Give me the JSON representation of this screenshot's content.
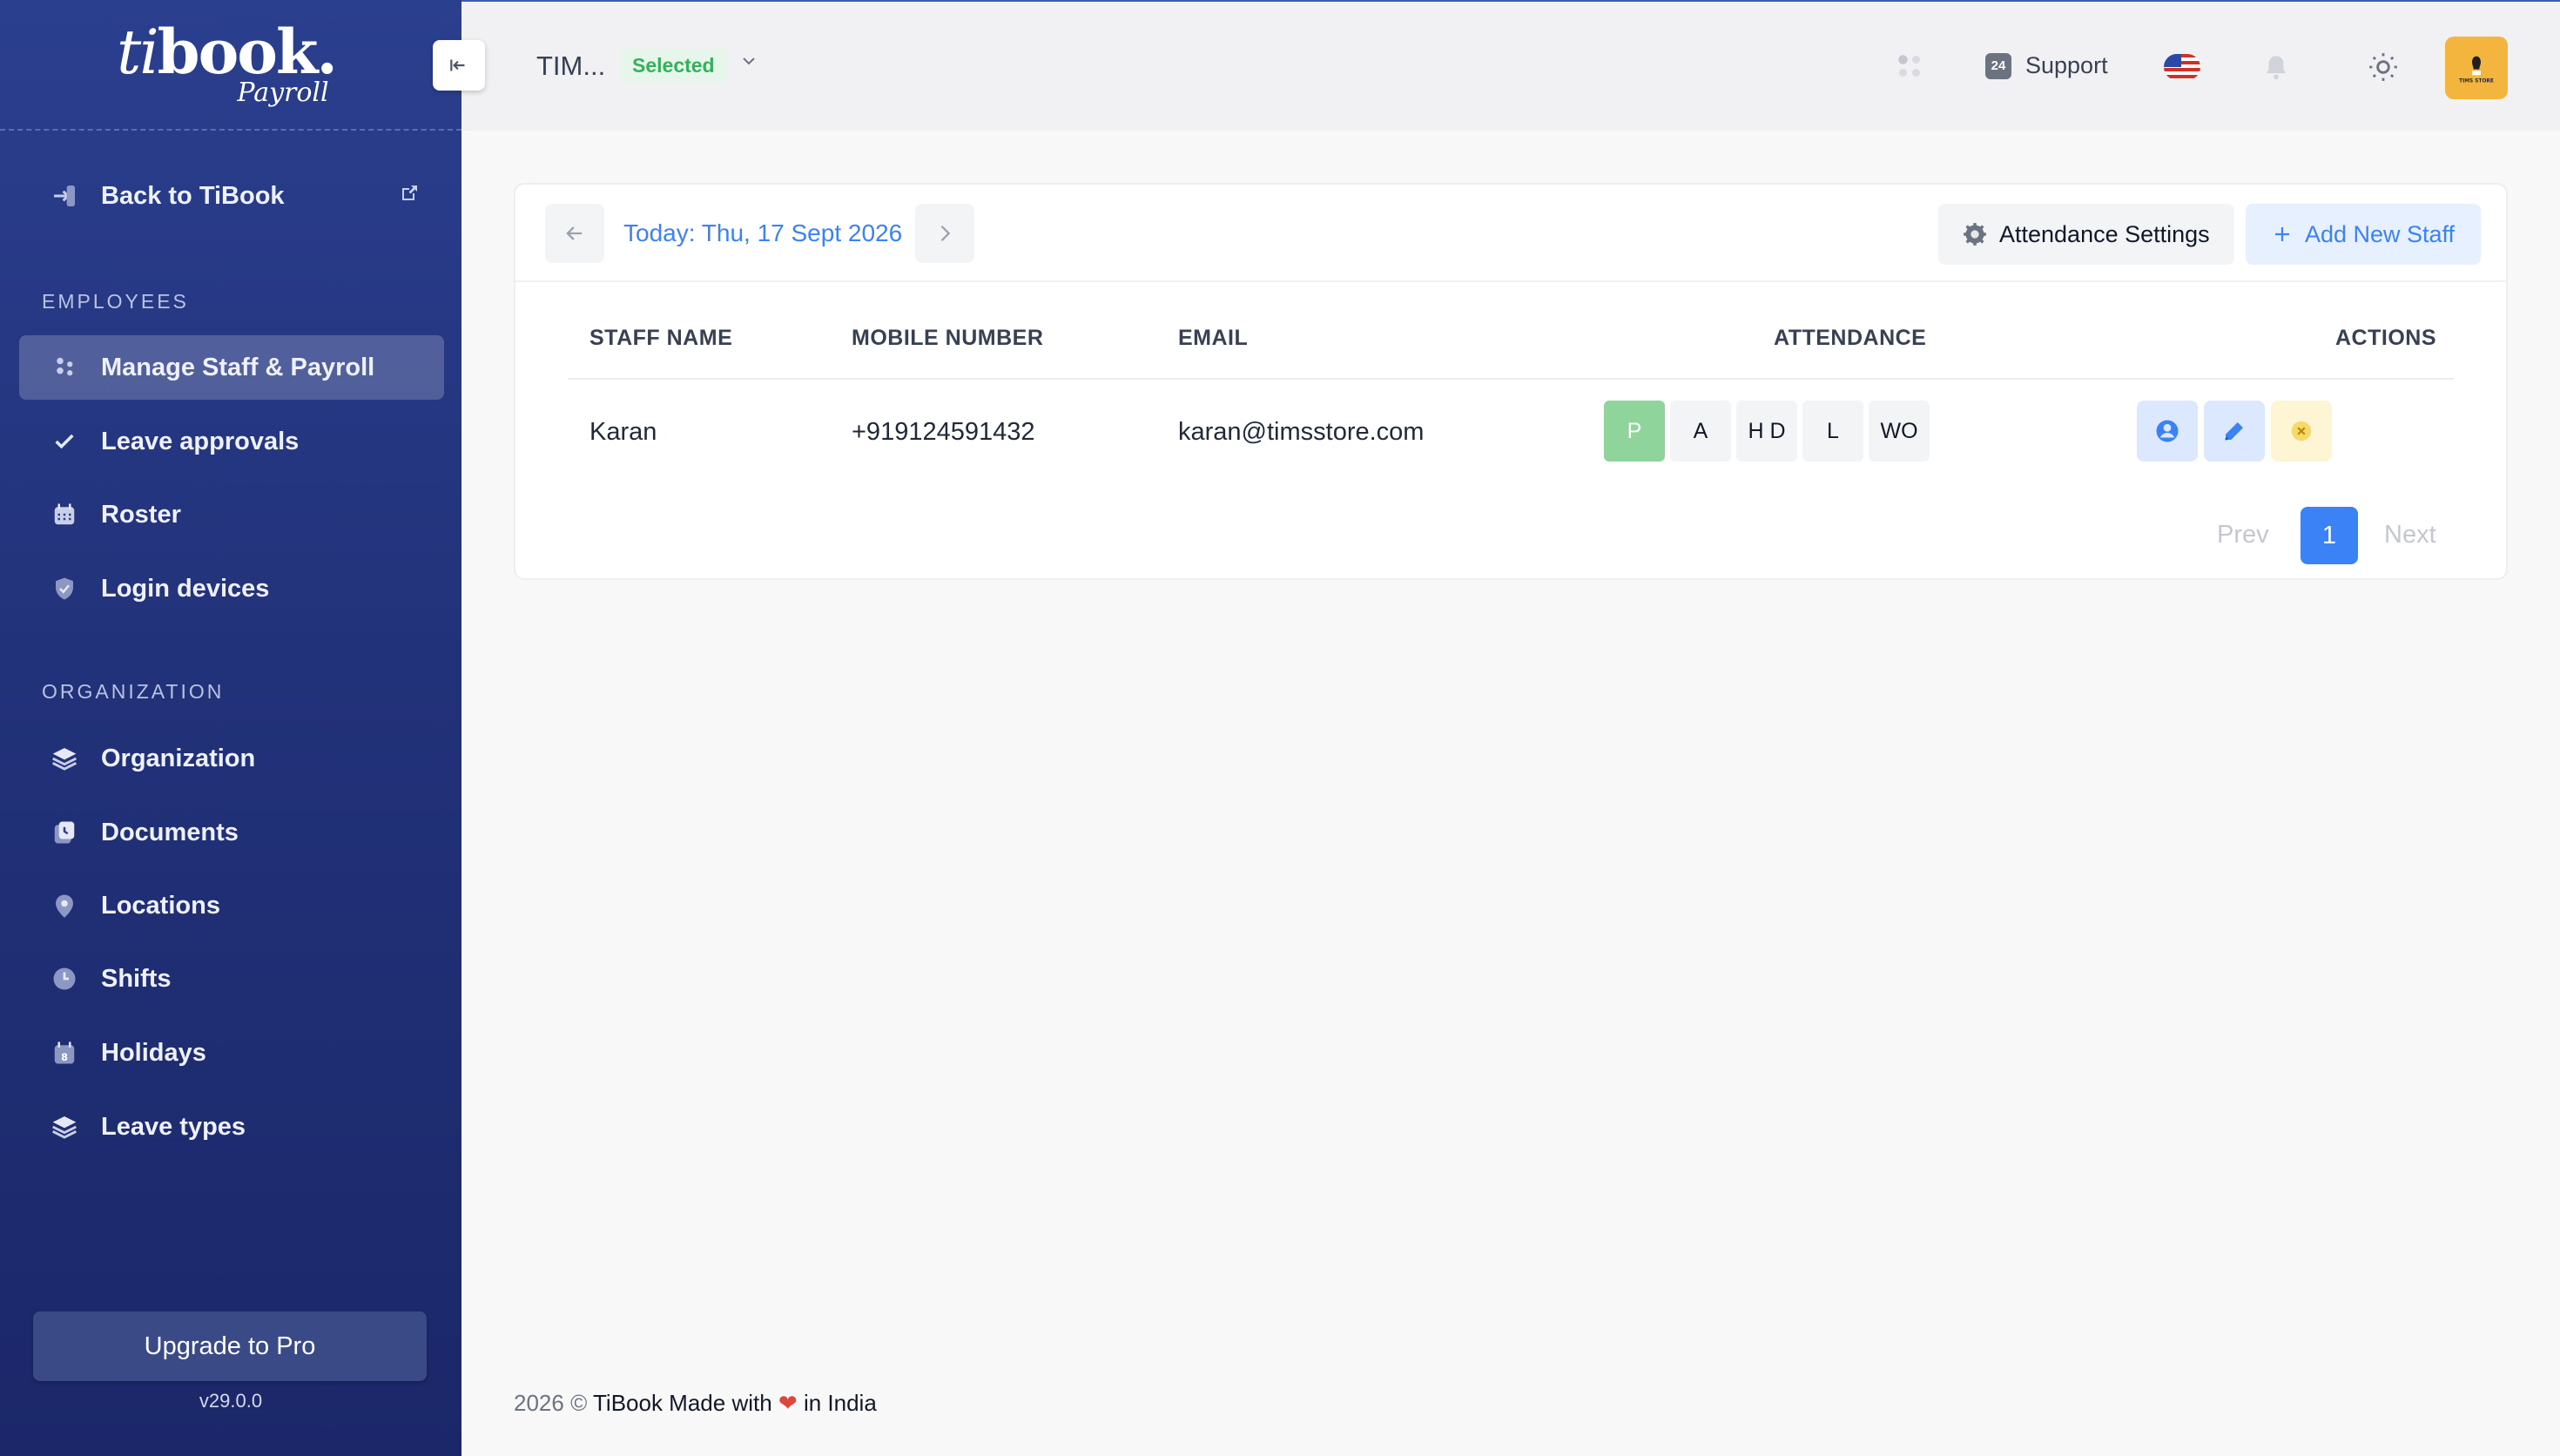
{
  "brand": {
    "logo_ti": "ti",
    "logo_book": "book.",
    "logo_sub": "Payroll"
  },
  "sidebar": {
    "back": "Back to TiBook",
    "sections": [
      {
        "label": "EMPLOYEES"
      },
      {
        "label": "ORGANIZATION"
      }
    ],
    "items": [
      {
        "label": "Manage Staff & Payroll",
        "icon": "users-icon"
      },
      {
        "label": "Leave approvals",
        "icon": "check-icon"
      },
      {
        "label": "Roster",
        "icon": "calendar-icon"
      },
      {
        "label": "Login devices",
        "icon": "shield-check-icon"
      },
      {
        "label": "Organization",
        "icon": "layers-icon"
      },
      {
        "label": "Documents",
        "icon": "documents-icon"
      },
      {
        "label": "Locations",
        "icon": "location-pin-icon"
      },
      {
        "label": "Shifts",
        "icon": "clock-icon"
      },
      {
        "label": "Holidays",
        "icon": "calendar-day-icon"
      },
      {
        "label": "Leave types",
        "icon": "layers-icon"
      }
    ],
    "upgrade": "Upgrade to Pro",
    "version": "v29.0.0"
  },
  "topbar": {
    "store": "TIM...",
    "badge": "Selected",
    "support": "Support",
    "support_badge": "24",
    "avatar_text": "TIMS STORE"
  },
  "date_nav": {
    "label": "Today: Thu, 17 Sept 2026"
  },
  "toolbar": {
    "attendance_settings": "Attendance Settings",
    "add_staff": "Add New Staff"
  },
  "table": {
    "headers": [
      "STAFF NAME",
      "MOBILE NUMBER",
      "EMAIL",
      "ATTENDANCE",
      "ACTIONS"
    ],
    "rows": [
      {
        "name": "Karan",
        "mobile": "+919124591432",
        "email": "karan@timsstore.com"
      }
    ],
    "attendance_options": [
      "P",
      "A",
      "H D",
      "L",
      "WO"
    ],
    "selected_attendance": "P"
  },
  "pagination": {
    "prev": "Prev",
    "page": "1",
    "next": "Next"
  },
  "footer": {
    "year": "2026 ©",
    "text1": "TiBook Made with",
    "text2": "in India"
  },
  "colors": {
    "accent": "#3b82f6",
    "sidebar": "#22327a",
    "present": "#8fd49b",
    "avatar": "#f4b53f"
  }
}
